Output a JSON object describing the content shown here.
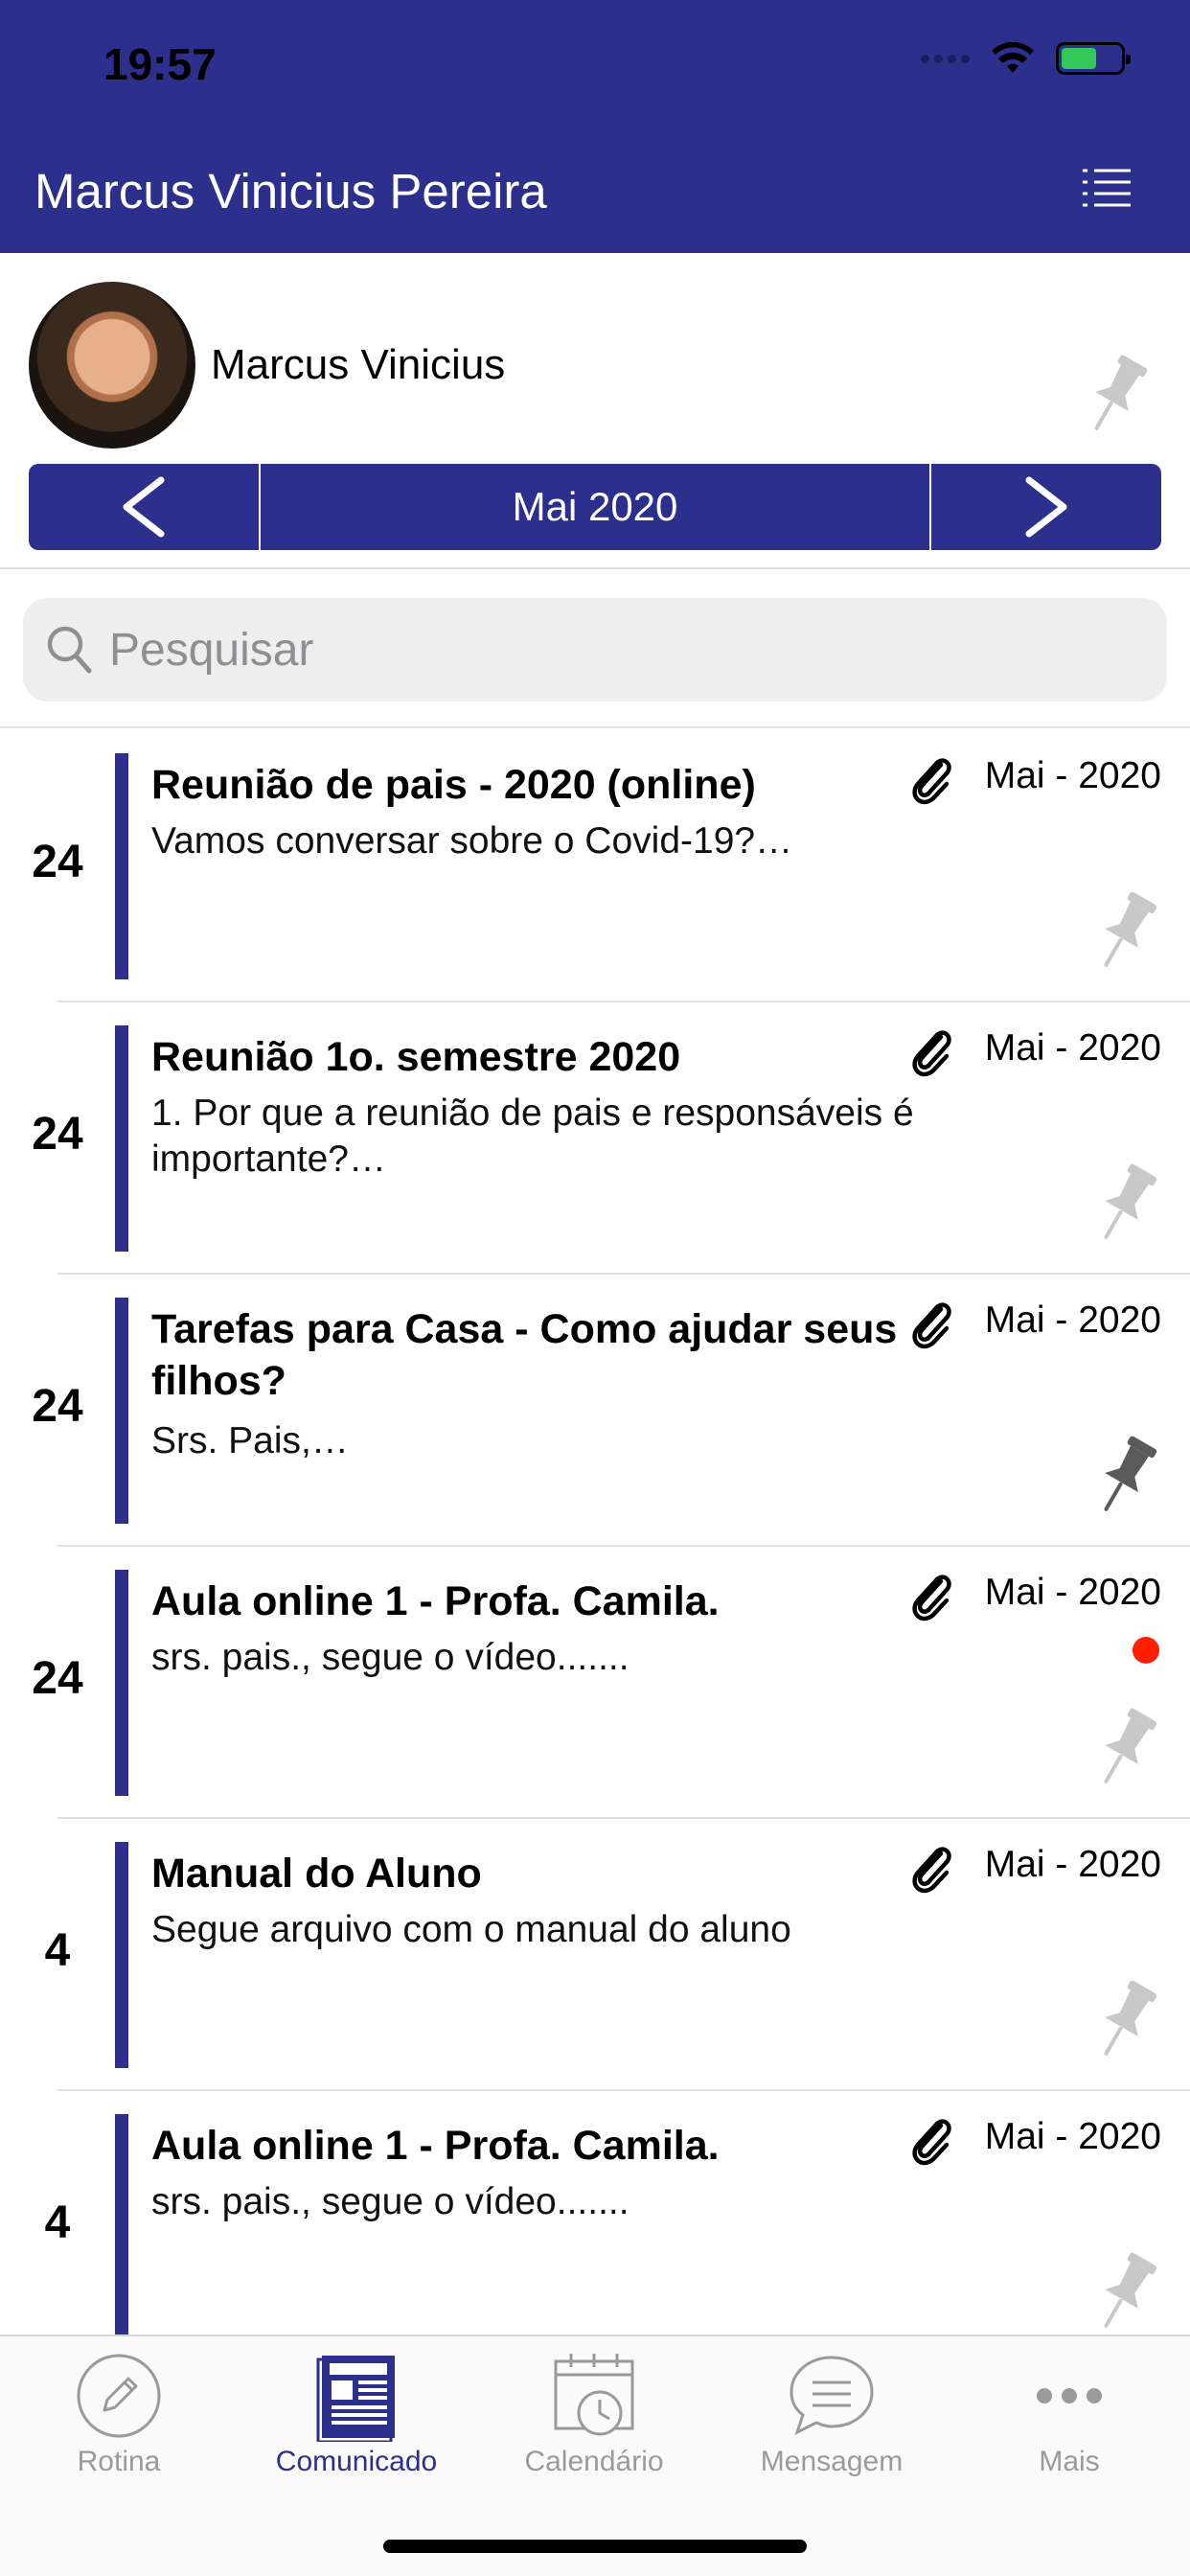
{
  "status_bar": {
    "time": "19:57"
  },
  "header": {
    "title": "Marcus Vinicius Pereira",
    "menu_icon": "list-menu-icon"
  },
  "student": {
    "name": "Marcus Vinicius"
  },
  "month_nav": {
    "label": "Mai 2020"
  },
  "search": {
    "placeholder": "Pesquisar"
  },
  "colors": {
    "brand": "#2c2f8c",
    "unread": "#ff1e00",
    "pin_inactive": "#c8c8c8",
    "pin_active": "#5a5a5a"
  },
  "announcements": [
    {
      "day": "24",
      "title": "Reunião de pais  - 2020 (online)",
      "preview": "Vamos conversar sobre o Covid-19?…",
      "date": "Mai - 2020",
      "has_attachment": true,
      "pinned": false,
      "unread": false
    },
    {
      "day": "24",
      "title": "Reunião 1o. semestre 2020",
      "preview": "1. Por que a reunião de pais e responsáveis é importante?…",
      "date": "Mai - 2020",
      "has_attachment": true,
      "pinned": false,
      "unread": false
    },
    {
      "day": "24",
      "title": "Tarefas para Casa - Como ajudar seus filhos?",
      "preview": "Srs. Pais,…",
      "date": "Mai - 2020",
      "has_attachment": true,
      "pinned": true,
      "unread": false
    },
    {
      "day": "24",
      "title": "Aula online 1 - Profa. Camila.",
      "preview": "srs. pais., segue o vídeo.......",
      "date": "Mai - 2020",
      "has_attachment": true,
      "pinned": false,
      "unread": true
    },
    {
      "day": "4",
      "title": "Manual do Aluno",
      "preview": "Segue arquivo com o manual do aluno",
      "date": "Mai - 2020",
      "has_attachment": true,
      "pinned": false,
      "unread": false
    },
    {
      "day": "4",
      "title": "Aula online 1 - Profa. Camila.",
      "preview": "srs. pais., segue o vídeo.......",
      "date": "Mai - 2020",
      "has_attachment": true,
      "pinned": false,
      "unread": false
    }
  ],
  "tabs": [
    {
      "label": "Rotina",
      "icon": "pencil-circle-icon",
      "active": false
    },
    {
      "label": "Comunicado",
      "icon": "newspaper-icon",
      "active": true
    },
    {
      "label": "Calendário",
      "icon": "calendar-clock-icon",
      "active": false
    },
    {
      "label": "Mensagem",
      "icon": "chat-bubble-icon",
      "active": false
    },
    {
      "label": "Mais",
      "icon": "more-dots-icon",
      "active": false
    }
  ]
}
